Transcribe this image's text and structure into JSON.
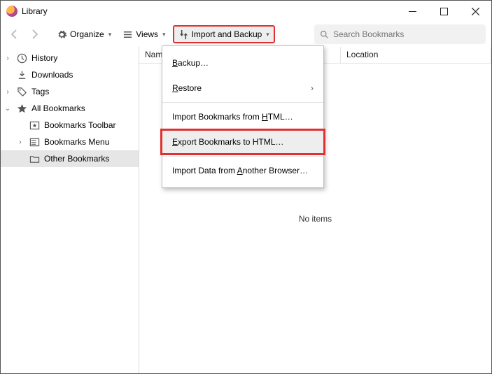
{
  "window": {
    "title": "Library"
  },
  "toolbar": {
    "organize": "Organize",
    "views": "Views",
    "import_backup": "Import and Backup",
    "search_placeholder": "Search Bookmarks"
  },
  "sidebar": {
    "history": "History",
    "downloads": "Downloads",
    "tags": "Tags",
    "all_bookmarks": "All Bookmarks",
    "bookmarks_toolbar": "Bookmarks Toolbar",
    "bookmarks_menu": "Bookmarks Menu",
    "other_bookmarks": "Other Bookmarks"
  },
  "columns": {
    "name": "Name",
    "location": "Location"
  },
  "menu": {
    "backup": "ackup…",
    "backup_u": "B",
    "restore": "estore",
    "restore_u": "R",
    "import_html_pre": "Import Bookmarks from ",
    "import_html_u": "H",
    "import_html_post": "TML…",
    "export_html_u": "E",
    "export_html_post": "xport Bookmarks to HTML…",
    "import_other_pre": "Import Data from ",
    "import_other_u": "A",
    "import_other_post": "nother Browser…"
  },
  "content": {
    "empty": "No items"
  }
}
